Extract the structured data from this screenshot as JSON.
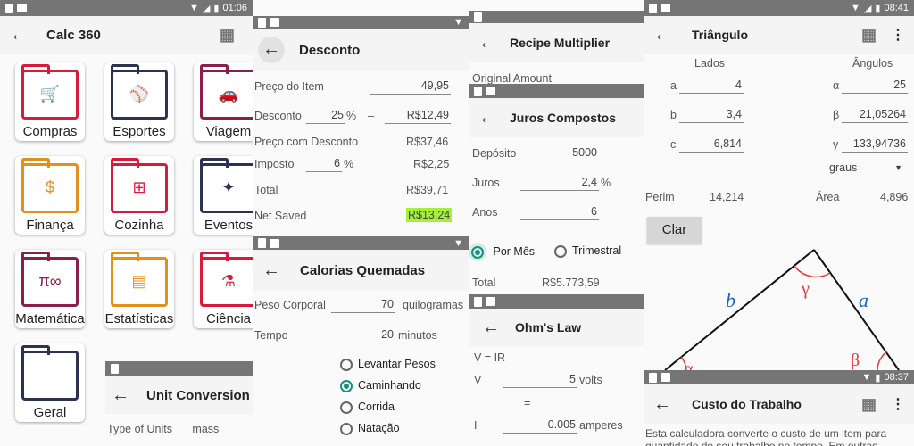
{
  "p1": {
    "status_time": "01:06",
    "title": "Calc 360",
    "categories": [
      {
        "label": "Compras",
        "icon": "cart-icon",
        "color": "#d81b3a"
      },
      {
        "label": "Esportes",
        "icon": "baseball-icon",
        "color": "#2c3352"
      },
      {
        "label": "Viagem",
        "icon": "car-icon",
        "color": "#8a1f4a"
      },
      {
        "label": "Finança",
        "icon": "money-icon",
        "color": "#e1901a"
      },
      {
        "label": "Cozinha",
        "icon": "mixer-icon",
        "color": "#d81b3a"
      },
      {
        "label": "Eventos",
        "icon": "party-icon",
        "color": "#2c3352"
      },
      {
        "label": "Matemática",
        "icon": "pi-infinity-icon",
        "color": "#8a1f4a",
        "glyph": "π∞"
      },
      {
        "label": "Estatísticas",
        "icon": "chart-icon",
        "color": "#e1901a"
      },
      {
        "label": "Ciência",
        "icon": "microscope-icon",
        "color": "#d81b3a"
      },
      {
        "label": "Geral",
        "icon": "folder-icon",
        "color": "#2c3352"
      }
    ]
  },
  "unit": {
    "title": "Unit Conversion",
    "type_label": "Type of Units",
    "type_value": "mass"
  },
  "desconto": {
    "title": "Desconto",
    "preco_label": "Preço do Item",
    "preco_value": "49,95",
    "desconto_label": "Desconto",
    "desconto_pct": "25",
    "pct_sign": "%",
    "minus": "–",
    "desconto_value": "R$12,49",
    "preco_desc_label": "Preço com Desconto",
    "preco_desc_value": "R$37,46",
    "imposto_label": "Imposto",
    "imposto_pct": "6",
    "imposto_value": "R$2,25",
    "total_label": "Total",
    "total_value": "R$39,71",
    "saved_label": "Net Saved",
    "saved_value": "R$13,24",
    "highlight": "#a6f03a"
  },
  "calorias": {
    "title": "Calorias Quemadas",
    "peso_label": "Peso Corporal",
    "peso_value": "70",
    "peso_unit": "quilogramas",
    "tempo_label": "Tempo",
    "tempo_value": "20",
    "tempo_unit": "minutos",
    "options": [
      "Levantar Pesos",
      "Caminhando",
      "Corrida",
      "Natação"
    ],
    "selected": "Caminhando"
  },
  "recipe": {
    "title": "Recipe Multiplier",
    "original_label": "Original Amount"
  },
  "juros": {
    "title": "Juros Compostos",
    "deposito_label": "Depósito",
    "deposito_value": "5000",
    "juros_label": "Juros",
    "juros_value": "2,4",
    "pct_sign": "%",
    "anos_label": "Anos",
    "anos_value": "6",
    "opt_mes": "Por Mês",
    "opt_tri": "Trimestral",
    "total_label": "Total",
    "total_value": "R$5.773,59"
  },
  "ohm": {
    "title": "Ohm's Law",
    "formula": "V = IR",
    "v_label": "V",
    "v_value": "5",
    "v_unit": "volts",
    "eq": "=",
    "i_label": "I",
    "i_value": "0.005",
    "i_unit": "amperes"
  },
  "triangulo": {
    "status_time": "08:41",
    "title": "Triângulo",
    "lados_header": "Lados",
    "angulos_header": "Ângulos",
    "a_label": "a",
    "a_value": "4",
    "b_label": "b",
    "b_value": "3,4",
    "c_label": "c",
    "c_value": "6,814",
    "alpha_label": "α",
    "alpha_value": "25",
    "beta_label": "β",
    "beta_value": "21,05264",
    "gamma_label": "γ",
    "gamma_value": "133,94736",
    "unit_select": "graus",
    "perim_label": "Perim",
    "perim_value": "14,214",
    "area_label": "Área",
    "area_value": "4,896",
    "clear_label": "Clar",
    "side_b": "b",
    "side_a": "a",
    "ang_gamma": "γ",
    "ang_beta": "β",
    "ang_alpha": "α"
  },
  "custo": {
    "status_time": "08:37",
    "title": "Custo do Trabalho",
    "description": "Esta calculadora converte o custo de um item para quantidade do seu trabalho no tempo. Em outras"
  }
}
